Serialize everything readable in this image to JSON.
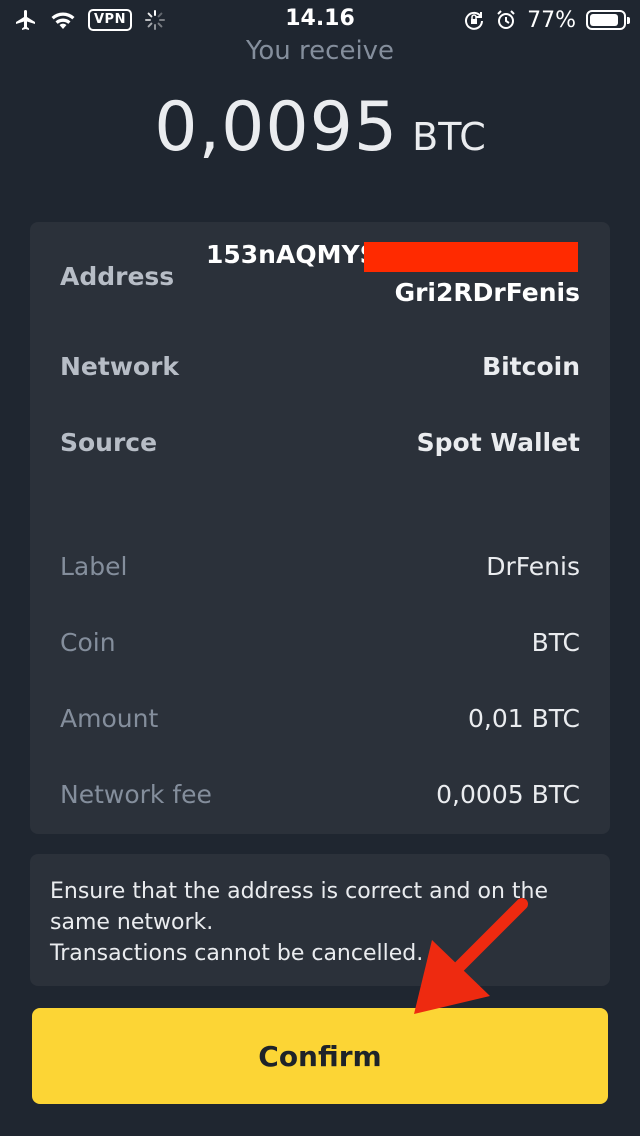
{
  "status_bar": {
    "time": "14.16",
    "vpn": "VPN",
    "battery": "77%",
    "icons": [
      "airplane-icon",
      "wifi-icon",
      "vpn-badge",
      "loading-icon",
      "rotation-lock-icon",
      "alarm-icon",
      "battery-icon"
    ]
  },
  "receive": {
    "label": "You receive",
    "amount": "0,0095",
    "unit": "BTC"
  },
  "details": {
    "address_label": "Address",
    "address_line1": "153nAQMYS",
    "address_line2": "Gri2RDrFenis",
    "network_label": "Network",
    "network_value": "Bitcoin",
    "source_label": "Source",
    "source_value": "Spot Wallet",
    "label_label": "Label",
    "label_value": "DrFenis",
    "coin_label": "Coin",
    "coin_value": "BTC",
    "amount_label": "Amount",
    "amount_value": "0,01 BTC",
    "fee_label": "Network fee",
    "fee_value": "0,0005 BTC"
  },
  "warning": {
    "line1": "Ensure that the address is correct and on the",
    "line2": "same network.",
    "line3": "Transactions cannot be cancelled."
  },
  "actions": {
    "confirm_label": "Confirm"
  },
  "colors": {
    "background": "#1f2630",
    "card": "#2b313a",
    "accent": "#fcd535",
    "redaction": "#ff2a00",
    "annotation_arrow": "#ee2a10"
  }
}
